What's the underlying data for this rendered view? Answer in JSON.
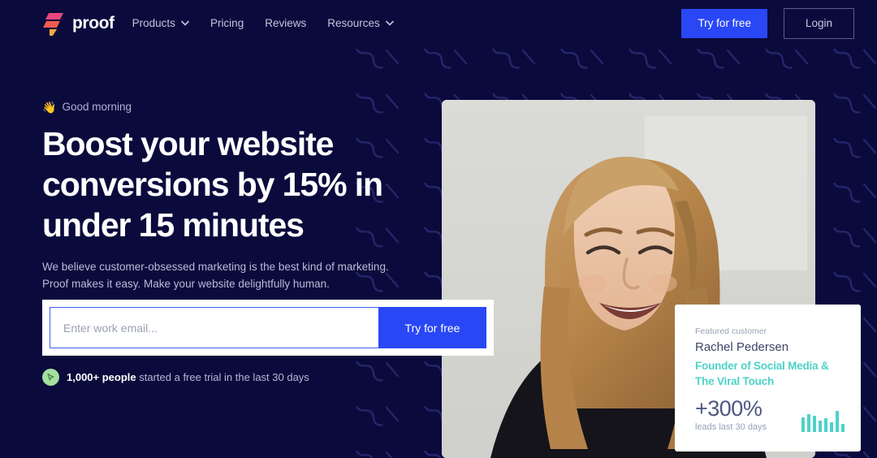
{
  "brand": {
    "name": "proof",
    "logo_icon": "proof-logo-icon",
    "logo_colors": [
      "#e8457c",
      "#ef5b4c",
      "#f5a93c"
    ]
  },
  "header": {
    "nav": [
      {
        "label": "Products",
        "has_dropdown": true,
        "icon": "chevron-down-icon"
      },
      {
        "label": "Pricing",
        "has_dropdown": false
      },
      {
        "label": "Reviews",
        "has_dropdown": false
      },
      {
        "label": "Resources",
        "has_dropdown": true,
        "icon": "chevron-down-icon"
      }
    ],
    "cta_label": "Try for free",
    "login_label": "Login"
  },
  "hero": {
    "greeting_emoji": "👋",
    "greeting": "Good morning",
    "headline": "Boost your website conversions by 15% in under 15 minutes",
    "subtext": "We believe customer-obsessed marketing is the best kind of marketing. Proof makes it easy. Make your website delightfully human.",
    "form": {
      "placeholder": "Enter work email...",
      "value": "",
      "submit_label": "Try for free"
    },
    "social_proof": {
      "badge_icon": "cursor-arrow-icon",
      "strong": "1,000+ people",
      "rest": " started a free trial in the last 30 days"
    },
    "photo_alt": "smiling-woman-photo"
  },
  "featured_card": {
    "label": "Featured customer",
    "name": "Rachel Pedersen",
    "role_line1": "Founder of Social Media &",
    "role_line2": "The Viral Touch",
    "stat": "+300%",
    "stat_sub": "leads last 30 days"
  },
  "chart_data": {
    "type": "bar",
    "title": "leads last 30 days sparkline",
    "categories": [
      "1",
      "2",
      "3",
      "4",
      "5",
      "6",
      "7",
      "8"
    ],
    "values": [
      18,
      22,
      20,
      14,
      17,
      12,
      26,
      10
    ],
    "ylim": [
      0,
      30
    ],
    "xlabel": "",
    "ylabel": "",
    "grid": false,
    "legend": false,
    "color": "#4ed2c8"
  },
  "colors": {
    "background": "#0a0a3c",
    "accent_blue": "#2947f5",
    "teal": "#4ed2c8",
    "green_badge": "#a5dfa0",
    "nav_text": "#c2c5dd"
  }
}
